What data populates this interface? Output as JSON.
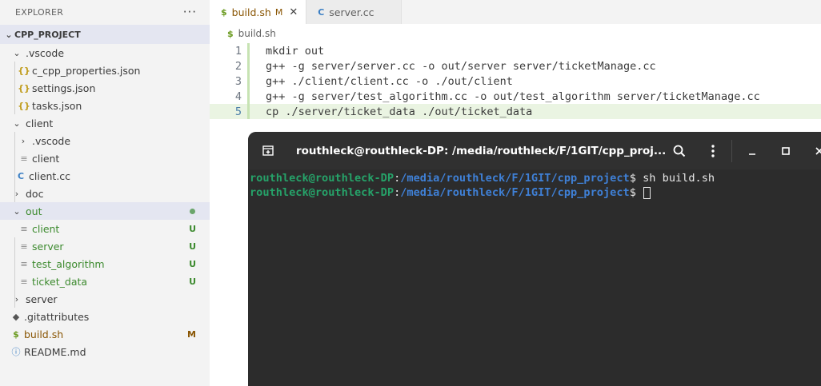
{
  "explorer": {
    "title": "EXPLORER",
    "more_actions": "···",
    "project": {
      "chevron": "⌄",
      "name": "CPP_PROJECT",
      "rows": [
        {
          "name": "vscode-folder",
          "label": ".vscode",
          "chevron": "⌄",
          "icon": "",
          "icon_type": "none",
          "indent": 14,
          "label_color": "normal",
          "badge": "",
          "badge_type": "",
          "selected": false
        },
        {
          "name": "c-cpp-properties-json",
          "label": "c_cpp_properties.json",
          "chevron": "",
          "icon": "{}",
          "icon_type": "json",
          "indent": 22,
          "label_color": "normal",
          "badge": "",
          "badge_type": "",
          "selected": false
        },
        {
          "name": "settings-json",
          "label": "settings.json",
          "chevron": "",
          "icon": "{}",
          "icon_type": "json",
          "indent": 22,
          "label_color": "normal",
          "badge": "",
          "badge_type": "",
          "selected": false
        },
        {
          "name": "tasks-json",
          "label": "tasks.json",
          "chevron": "",
          "icon": "{}",
          "icon_type": "json",
          "indent": 22,
          "label_color": "normal",
          "badge": "",
          "badge_type": "",
          "selected": false
        },
        {
          "name": "client-folder",
          "label": "client",
          "chevron": "⌄",
          "icon": "",
          "icon_type": "none",
          "indent": 14,
          "label_color": "normal",
          "badge": "",
          "badge_type": "",
          "selected": false
        },
        {
          "name": "client-vscode-folder",
          "label": ".vscode",
          "chevron": "›",
          "icon": "",
          "icon_type": "none",
          "indent": 22,
          "label_color": "normal",
          "badge": "",
          "badge_type": "",
          "selected": false
        },
        {
          "name": "client-binary",
          "label": "client",
          "chevron": "",
          "icon": "≡",
          "icon_type": "doc",
          "indent": 22,
          "label_color": "normal",
          "badge": "",
          "badge_type": "",
          "selected": false
        },
        {
          "name": "client-cc",
          "label": "client.cc",
          "chevron": "",
          "icon": "C",
          "icon_type": "cc",
          "indent": 18,
          "label_color": "normal",
          "badge": "",
          "badge_type": "",
          "selected": false
        },
        {
          "name": "doc-folder",
          "label": "doc",
          "chevron": "›",
          "icon": "",
          "icon_type": "none",
          "indent": 14,
          "label_color": "normal",
          "badge": "",
          "badge_type": "",
          "selected": false
        },
        {
          "name": "out-folder",
          "label": "out",
          "chevron": "⌄",
          "icon": "",
          "icon_type": "none",
          "indent": 14,
          "label_color": "green",
          "badge": "dot",
          "badge_type": "dot",
          "selected": true
        },
        {
          "name": "out-client",
          "label": "client",
          "chevron": "",
          "icon": "≡",
          "icon_type": "doc",
          "indent": 22,
          "label_color": "green",
          "badge": "U",
          "badge_type": "u",
          "selected": false
        },
        {
          "name": "out-server",
          "label": "server",
          "chevron": "",
          "icon": "≡",
          "icon_type": "doc",
          "indent": 22,
          "label_color": "green",
          "badge": "U",
          "badge_type": "u",
          "selected": false
        },
        {
          "name": "out-test-algorithm",
          "label": "test_algorithm",
          "chevron": "",
          "icon": "≡",
          "icon_type": "doc",
          "indent": 22,
          "label_color": "green",
          "badge": "U",
          "badge_type": "u",
          "selected": false
        },
        {
          "name": "out-ticket-data",
          "label": "ticket_data",
          "chevron": "",
          "icon": "≡",
          "icon_type": "doc",
          "indent": 22,
          "label_color": "green",
          "badge": "U",
          "badge_type": "u",
          "selected": false
        },
        {
          "name": "server-folder",
          "label": "server",
          "chevron": "›",
          "icon": "",
          "icon_type": "none",
          "indent": 14,
          "label_color": "normal",
          "badge": "",
          "badge_type": "",
          "selected": false
        },
        {
          "name": "gitattributes",
          "label": ".gitattributes",
          "chevron": "",
          "icon": "◆",
          "icon_type": "git",
          "indent": 12,
          "label_color": "normal",
          "badge": "",
          "badge_type": "",
          "selected": false
        },
        {
          "name": "build-sh",
          "label": "build.sh",
          "chevron": "",
          "icon": "$",
          "icon_type": "sh",
          "indent": 12,
          "label_color": "mod",
          "badge": "M",
          "badge_type": "m",
          "selected": false
        },
        {
          "name": "readme-md",
          "label": "README.md",
          "chevron": "",
          "icon": "ⓘ",
          "icon_type": "info",
          "indent": 12,
          "label_color": "normal",
          "badge": "",
          "badge_type": "",
          "selected": false
        }
      ]
    }
  },
  "editor": {
    "tabs": [
      {
        "label": "build.sh",
        "icon": "$",
        "modified": "M",
        "close": "✕"
      },
      {
        "label": "server.cc",
        "icon": "C"
      }
    ],
    "breadcrumb": {
      "icon": "$",
      "file": "build.sh"
    },
    "lines": [
      {
        "n": "1",
        "text": "mkdir out"
      },
      {
        "n": "2",
        "text": "g++ -g server/server.cc -o out/server server/ticketManage.cc"
      },
      {
        "n": "3",
        "text": "g++ ./client/client.cc -o ./out/client"
      },
      {
        "n": "4",
        "text": "g++ -g server/test_algorithm.cc -o out/test_algorithm server/ticketManage.cc"
      },
      {
        "n": "5",
        "text": "cp ./server/ticket_data ./out/ticket_data"
      }
    ]
  },
  "terminal": {
    "title": "routhleck@routhleck-DP: /media/routhleck/F/1GIT/cpp_proj...",
    "lines": [
      {
        "user": "routhleck@routhleck-DP",
        "colon": ":",
        "path": "/media/routhleck/F/1GIT/cpp_project",
        "dollar": "$ ",
        "command": "sh build.sh"
      },
      {
        "user": "routhleck@routhleck-DP",
        "colon": ":",
        "path": "/media/routhleck/F/1GIT/cpp_project",
        "dollar": "$ ",
        "command": ""
      }
    ],
    "icons": [
      "new-tab-icon",
      "search-icon",
      "kebab-menu-icon",
      "minimize-icon",
      "maximize-icon",
      "close-icon"
    ]
  }
}
